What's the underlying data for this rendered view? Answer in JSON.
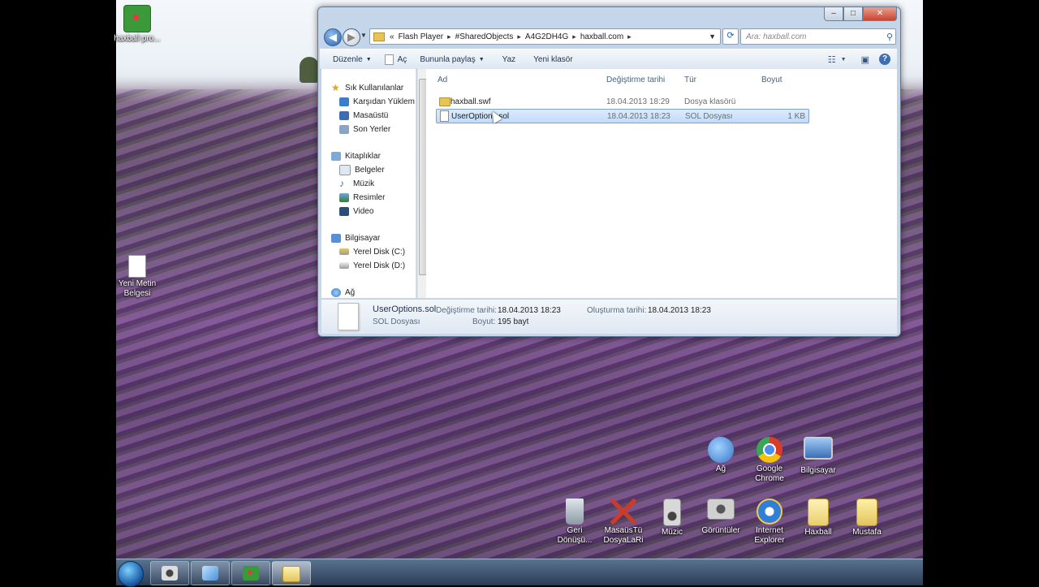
{
  "desktop": {
    "icons_top_left": [
      {
        "name": "haxball-pro-shortcut",
        "label": "haxball pro...",
        "icon": "haxball-icon",
        "color": "#3a9a3a"
      },
      {
        "name": "new-text-document",
        "label_line1": "Yeni Metin",
        "label_line2": "Belgesi",
        "icon": "text-document-icon",
        "color": "#ffffff"
      }
    ],
    "icons_bottom_right_row1": [
      {
        "label": "Ağ",
        "icon": "network-icon",
        "color": "#3a74c8"
      },
      {
        "label_line1": "Google",
        "label_line2": "Chrome",
        "icon": "chrome-icon",
        "color": "#db3b2b"
      },
      {
        "label": "Bilgisayar",
        "icon": "computer-icon",
        "color": "#5a8fd6"
      }
    ],
    "icons_bottom_right_row2": [
      {
        "label_line1": "Geri",
        "label_line2": "Dönüşü...",
        "icon": "recycle-bin-icon",
        "color": "#9aa8b4"
      },
      {
        "label_line1": "MasaüsTü",
        "label_line2": "DosyaLaRi",
        "icon": "desktop-files-icon",
        "color": "#c83c2a"
      },
      {
        "label": "Müzic",
        "icon": "speaker-icon",
        "color": "#b8b8b8"
      },
      {
        "label": "Görüntüler",
        "icon": "camera-icon",
        "color": "#c8c8c8"
      },
      {
        "label_line1": "Internet",
        "label_line2": "Explorer",
        "icon": "internet-explorer-icon",
        "color": "#2f7ed8"
      },
      {
        "label": "Haxball",
        "icon": "folder-icon",
        "color": "#e9cf6b"
      },
      {
        "label": "Mustafa",
        "icon": "folder-icon",
        "color": "#e2c45c"
      }
    ]
  },
  "explorer": {
    "address": {
      "overflow": "«",
      "crumbs": [
        "Flash Player",
        "#SharedObjects",
        "A4G2DH4G",
        "haxball.com"
      ]
    },
    "search_placeholder": "Ara: haxball.com",
    "toolbar": {
      "organize": "Düzenle",
      "open": "Aç",
      "share": "Bununla paylaş",
      "burn": "Yaz",
      "new_folder": "Yeni klasör",
      "help": "?"
    },
    "nav": {
      "favorites_header": "Sık Kullanılanlar",
      "favorites": [
        "Karşıdan Yüklem",
        "Masaüstü",
        "Son Yerler"
      ],
      "libraries_header": "Kitaplıklar",
      "libraries": [
        "Belgeler",
        "Müzik",
        "Resimler",
        "Video"
      ],
      "computer_header": "Bilgisayar",
      "drives": [
        "Yerel Disk (C:)",
        "Yerel Disk (D:)"
      ],
      "network_header": "Ağ"
    },
    "columns": {
      "name": "Ad",
      "modified": "Değiştirme tarihi",
      "type": "Tür",
      "size": "Boyut"
    },
    "files": [
      {
        "name": "haxball.swf",
        "modified": "18.04.2013 18:29",
        "type": "Dosya klasörü",
        "size": "",
        "selected": false,
        "icon": "folder-icon"
      },
      {
        "name": "UserOptions.sol",
        "modified": "18.04.2013 18:23",
        "type": "SOL Dosyası",
        "size": "1 KB",
        "selected": true,
        "icon": "document-icon"
      }
    ],
    "details": {
      "filename": "UserOptions.sol",
      "filetype": "SOL Dosyası",
      "modified_label": "Değiştirme tarihi:",
      "modified_value": "18.04.2013 18:23",
      "size_label": "Boyut:",
      "size_value": "195 bayt",
      "created_label": "Oluşturma tarihi:",
      "created_value": "18.04.2013 18:23"
    }
  },
  "colors": {
    "selection": "#c1dcfc",
    "accent": "#2a62b0"
  }
}
